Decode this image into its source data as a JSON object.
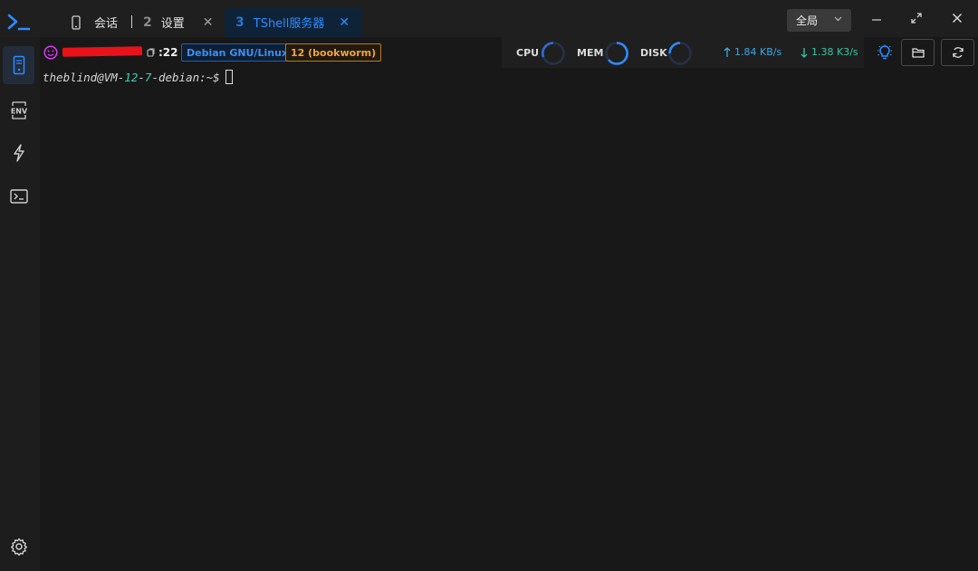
{
  "tabs": [
    {
      "label": "会话",
      "icon": "phone-icon"
    },
    {
      "number": "2",
      "label": "设置",
      "close": "✕"
    },
    {
      "number": "3",
      "label": "TShell服务器",
      "close": "✕"
    }
  ],
  "window": {
    "scope_label": "全局",
    "minimize": "—",
    "close": "✕"
  },
  "sidebar": {
    "items": [
      {
        "name": "server",
        "icon": "server-icon",
        "active": true
      },
      {
        "name": "env",
        "icon": "env-icon",
        "label": "ENV"
      },
      {
        "name": "snippets",
        "icon": "bolt-icon"
      },
      {
        "name": "terminal",
        "icon": "terminal-icon"
      },
      {
        "name": "settings",
        "icon": "gear-icon"
      }
    ]
  },
  "info": {
    "port": ":22",
    "os": "Debian GNU/Linux",
    "version": "12 (bookworm)",
    "host_redacted": true
  },
  "monitor": {
    "cpu_label": "CPU",
    "mem_label": "MEM",
    "disk_label": "DISK",
    "upload": "1.84 KB/s",
    "download": "1.38 K3/s"
  },
  "terminal": {
    "prompt_user": "theblind@VM-",
    "prompt_num1": "12",
    "prompt_dash": "-",
    "prompt_num2": "7",
    "prompt_rest": "-debian:~$"
  },
  "colors": {
    "accent": "#2d8cff",
    "os_badge": "#3d8ef0",
    "version_badge": "#f0a43a",
    "upload": "#3ba7e8",
    "download": "#38c6a4",
    "face": "#d63cf0"
  }
}
